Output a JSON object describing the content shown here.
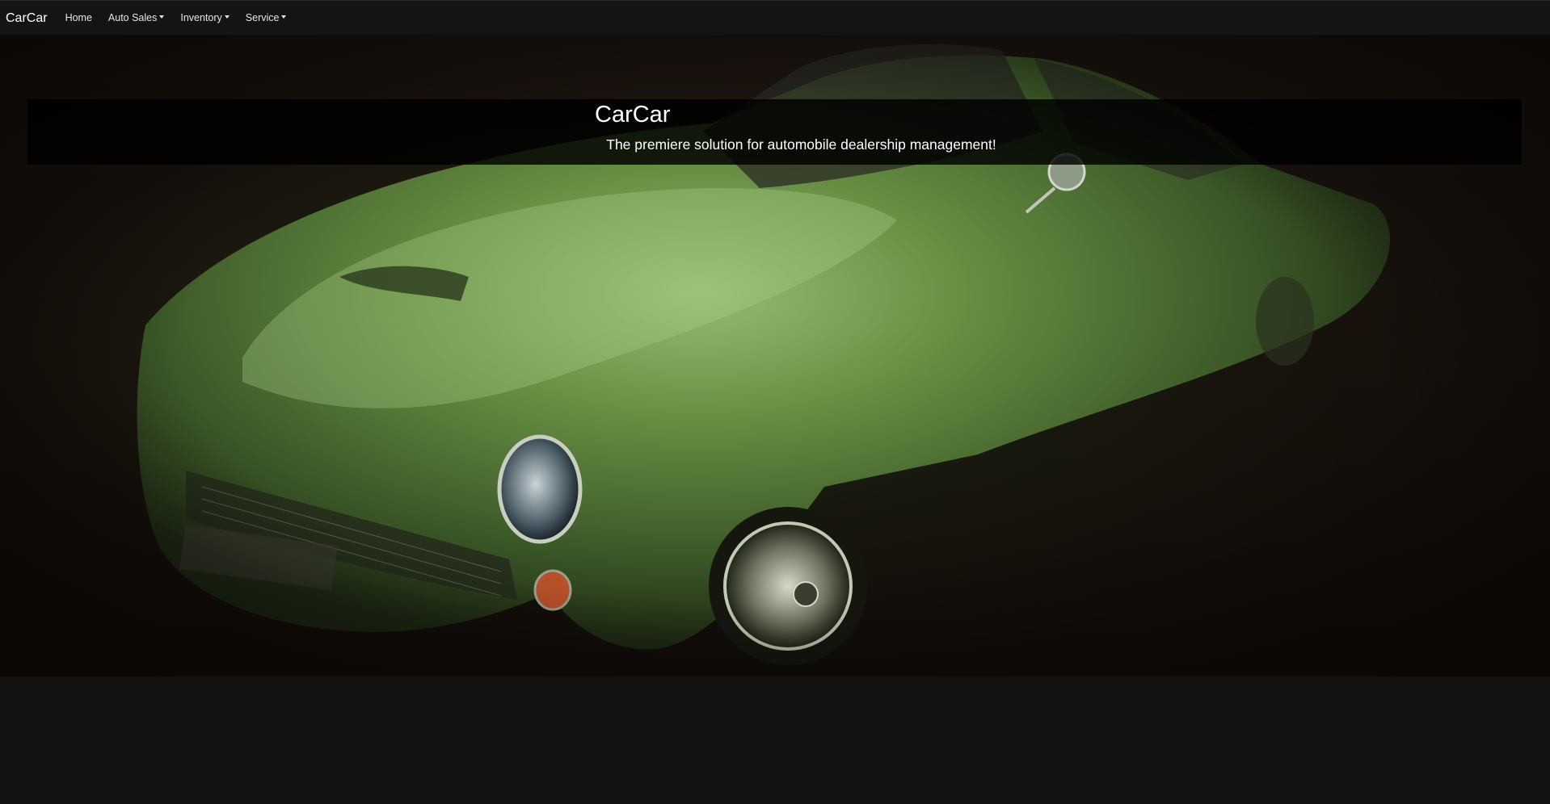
{
  "navbar": {
    "brand": "CarCar",
    "items": [
      {
        "label": "Home",
        "dropdown": false
      },
      {
        "label": "Auto Sales",
        "dropdown": true
      },
      {
        "label": "Inventory",
        "dropdown": true
      },
      {
        "label": "Service",
        "dropdown": true
      }
    ]
  },
  "hero": {
    "title": "CarCar",
    "subtitle": "The premiere solution for automobile dealership management!",
    "background_image": "green vintage car"
  },
  "colors": {
    "navbar_bg": "#141414",
    "page_bg": "#121212",
    "car_green": "#5f8a3c"
  }
}
